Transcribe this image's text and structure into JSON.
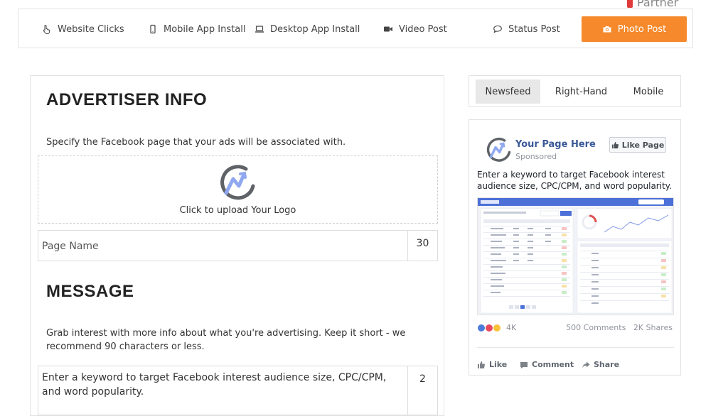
{
  "partner": {
    "label": "Partner"
  },
  "ad_types": {
    "website_clicks": "Website Clicks",
    "mobile_app_install": "Mobile App Install",
    "desktop_app_install": "Desktop App Install",
    "video_post": "Video Post",
    "status_post": "Status Post",
    "photo_post": "Photo Post"
  },
  "colors": {
    "accent": "#f6892b",
    "facebook_blue": "#3b5998",
    "logo_blue": "#8fa8f0",
    "logo_gray": "#5f6368"
  },
  "advertiser": {
    "title": "ADVERTISER INFO",
    "description": "Specify the Facebook page that your ads will be associated with.",
    "upload_label": "Click to upload Your Logo",
    "page_name_placeholder": "Page Name",
    "page_name_count": "30"
  },
  "message": {
    "title": "MESSAGE",
    "description": "Grab interest with more info about what you're advertising. Keep it short - we recommend 90 characters or less.",
    "value": "Enter a keyword to target Facebook interest audience size, CPC/CPM, and word popularity.",
    "count": "2"
  },
  "preview_tabs": {
    "newsfeed": "Newsfeed",
    "right_hand": "Right-Hand",
    "mobile": "Mobile",
    "active": "newsfeed"
  },
  "preview": {
    "page_name": "Your Page Here",
    "sponsored": "Sponsored",
    "like_page": "Like Page",
    "text": "Enter a keyword to target Facebook interest audience size, CPC/CPM, and word popularity.",
    "reactions_count": "4K",
    "comments": "500 Comments",
    "shares": "2K Shares",
    "actions": {
      "like": "Like",
      "comment": "Comment",
      "share": "Share"
    }
  }
}
